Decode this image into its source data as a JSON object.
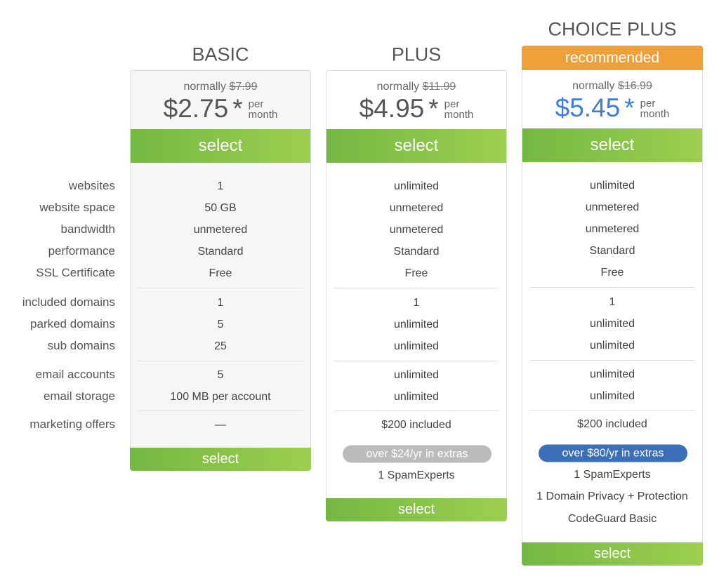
{
  "labels": [
    "websites",
    "website space",
    "bandwidth",
    "performance",
    "SSL Certificate",
    "included domains",
    "parked domains",
    "sub domains",
    "email accounts",
    "email storage",
    "marketing offers"
  ],
  "plans": [
    {
      "title": "BASIC",
      "normally": "normally",
      "old_price": "$7.99",
      "price": "$2.75",
      "asterisk": "*",
      "per": "per",
      "month": "month",
      "select": "select",
      "values": [
        "1",
        "50 GB",
        "unmetered",
        "Standard",
        "Free",
        "1",
        "5",
        "25",
        "5",
        "100 MB per account",
        "—"
      ],
      "bottom_select": "select"
    },
    {
      "title": "PLUS",
      "normally": "normally",
      "old_price": "$11.99",
      "price": "$4.95",
      "asterisk": "*",
      "per": "per",
      "month": "month",
      "select": "select",
      "values": [
        "unlimited",
        "unmetered",
        "unmetered",
        "Standard",
        "Free",
        "1",
        "unlimited",
        "unlimited",
        "unlimited",
        "unlimited",
        "$200 included"
      ],
      "badge": "over $24/yr in extras",
      "extras": [
        "1 SpamExperts"
      ],
      "bottom_select": "select"
    },
    {
      "title": "CHOICE PLUS",
      "recommended": "recommended",
      "normally": "normally",
      "old_price": "$16.99",
      "price": "$5.45",
      "asterisk": "*",
      "per": "per",
      "month": "month",
      "select": "select",
      "values": [
        "unlimited",
        "unmetered",
        "unmetered",
        "Standard",
        "Free",
        "1",
        "unlimited",
        "unlimited",
        "unlimited",
        "unlimited",
        "$200 included"
      ],
      "badge": "over $80/yr in extras",
      "extras": [
        "1 SpamExperts",
        "1 Domain Privacy + Protection",
        "CodeGuard Basic"
      ],
      "bottom_select": "select"
    }
  ],
  "colors": {
    "green": "#8cc84b",
    "orange": "#eea03a",
    "blue": "#3b7dd8",
    "gray_badge": "#bbbbbb"
  }
}
